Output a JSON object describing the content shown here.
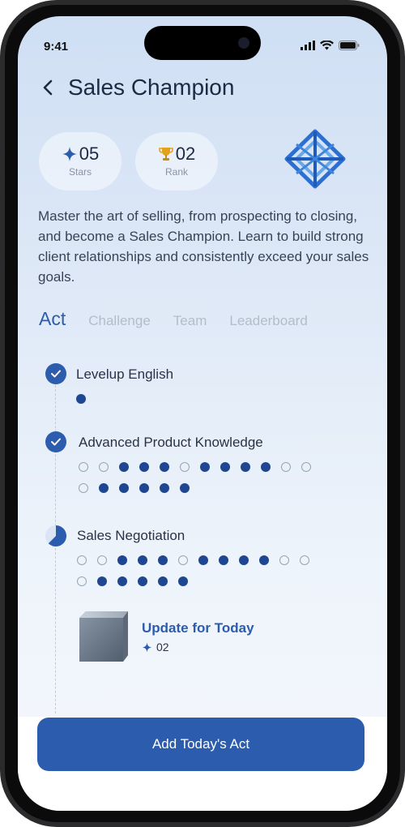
{
  "status": {
    "time": "9:41"
  },
  "header": {
    "title": "Sales Champion"
  },
  "stats": [
    {
      "value": "05",
      "label": "Stars",
      "icon": "sparkle-icon"
    },
    {
      "value": "02",
      "label": "Rank",
      "icon": "trophy-icon"
    }
  ],
  "description": "Master the art of selling, from prospecting to closing, and become a Sales Champion. Learn to build strong client relationships and consistently exceed your sales goals.",
  "tabs": [
    {
      "label": "Act",
      "active": true
    },
    {
      "label": "Challenge"
    },
    {
      "label": "Team"
    },
    {
      "label": "Leaderboard"
    }
  ],
  "steps": [
    {
      "title": "Levelup English",
      "status": "complete",
      "dots": [
        1
      ]
    },
    {
      "title": "Advanced Product Knowledge",
      "status": "complete",
      "dots": [
        0,
        0,
        1,
        1,
        1,
        0,
        1,
        1,
        1,
        1,
        0,
        0,
        0,
        1,
        1,
        1,
        1,
        1
      ]
    },
    {
      "title": "Sales Negotiation",
      "status": "in-progress",
      "dots": [
        0,
        0,
        1,
        1,
        1,
        0,
        1,
        1,
        1,
        1,
        0,
        0,
        0,
        1,
        1,
        1,
        1,
        1
      ]
    }
  ],
  "update": {
    "title": "Update for Today",
    "value": "02"
  },
  "cta": {
    "label": "Add Today's Act"
  },
  "colors": {
    "accent": "#2c5cad",
    "dot_filled": "#1f4690"
  }
}
